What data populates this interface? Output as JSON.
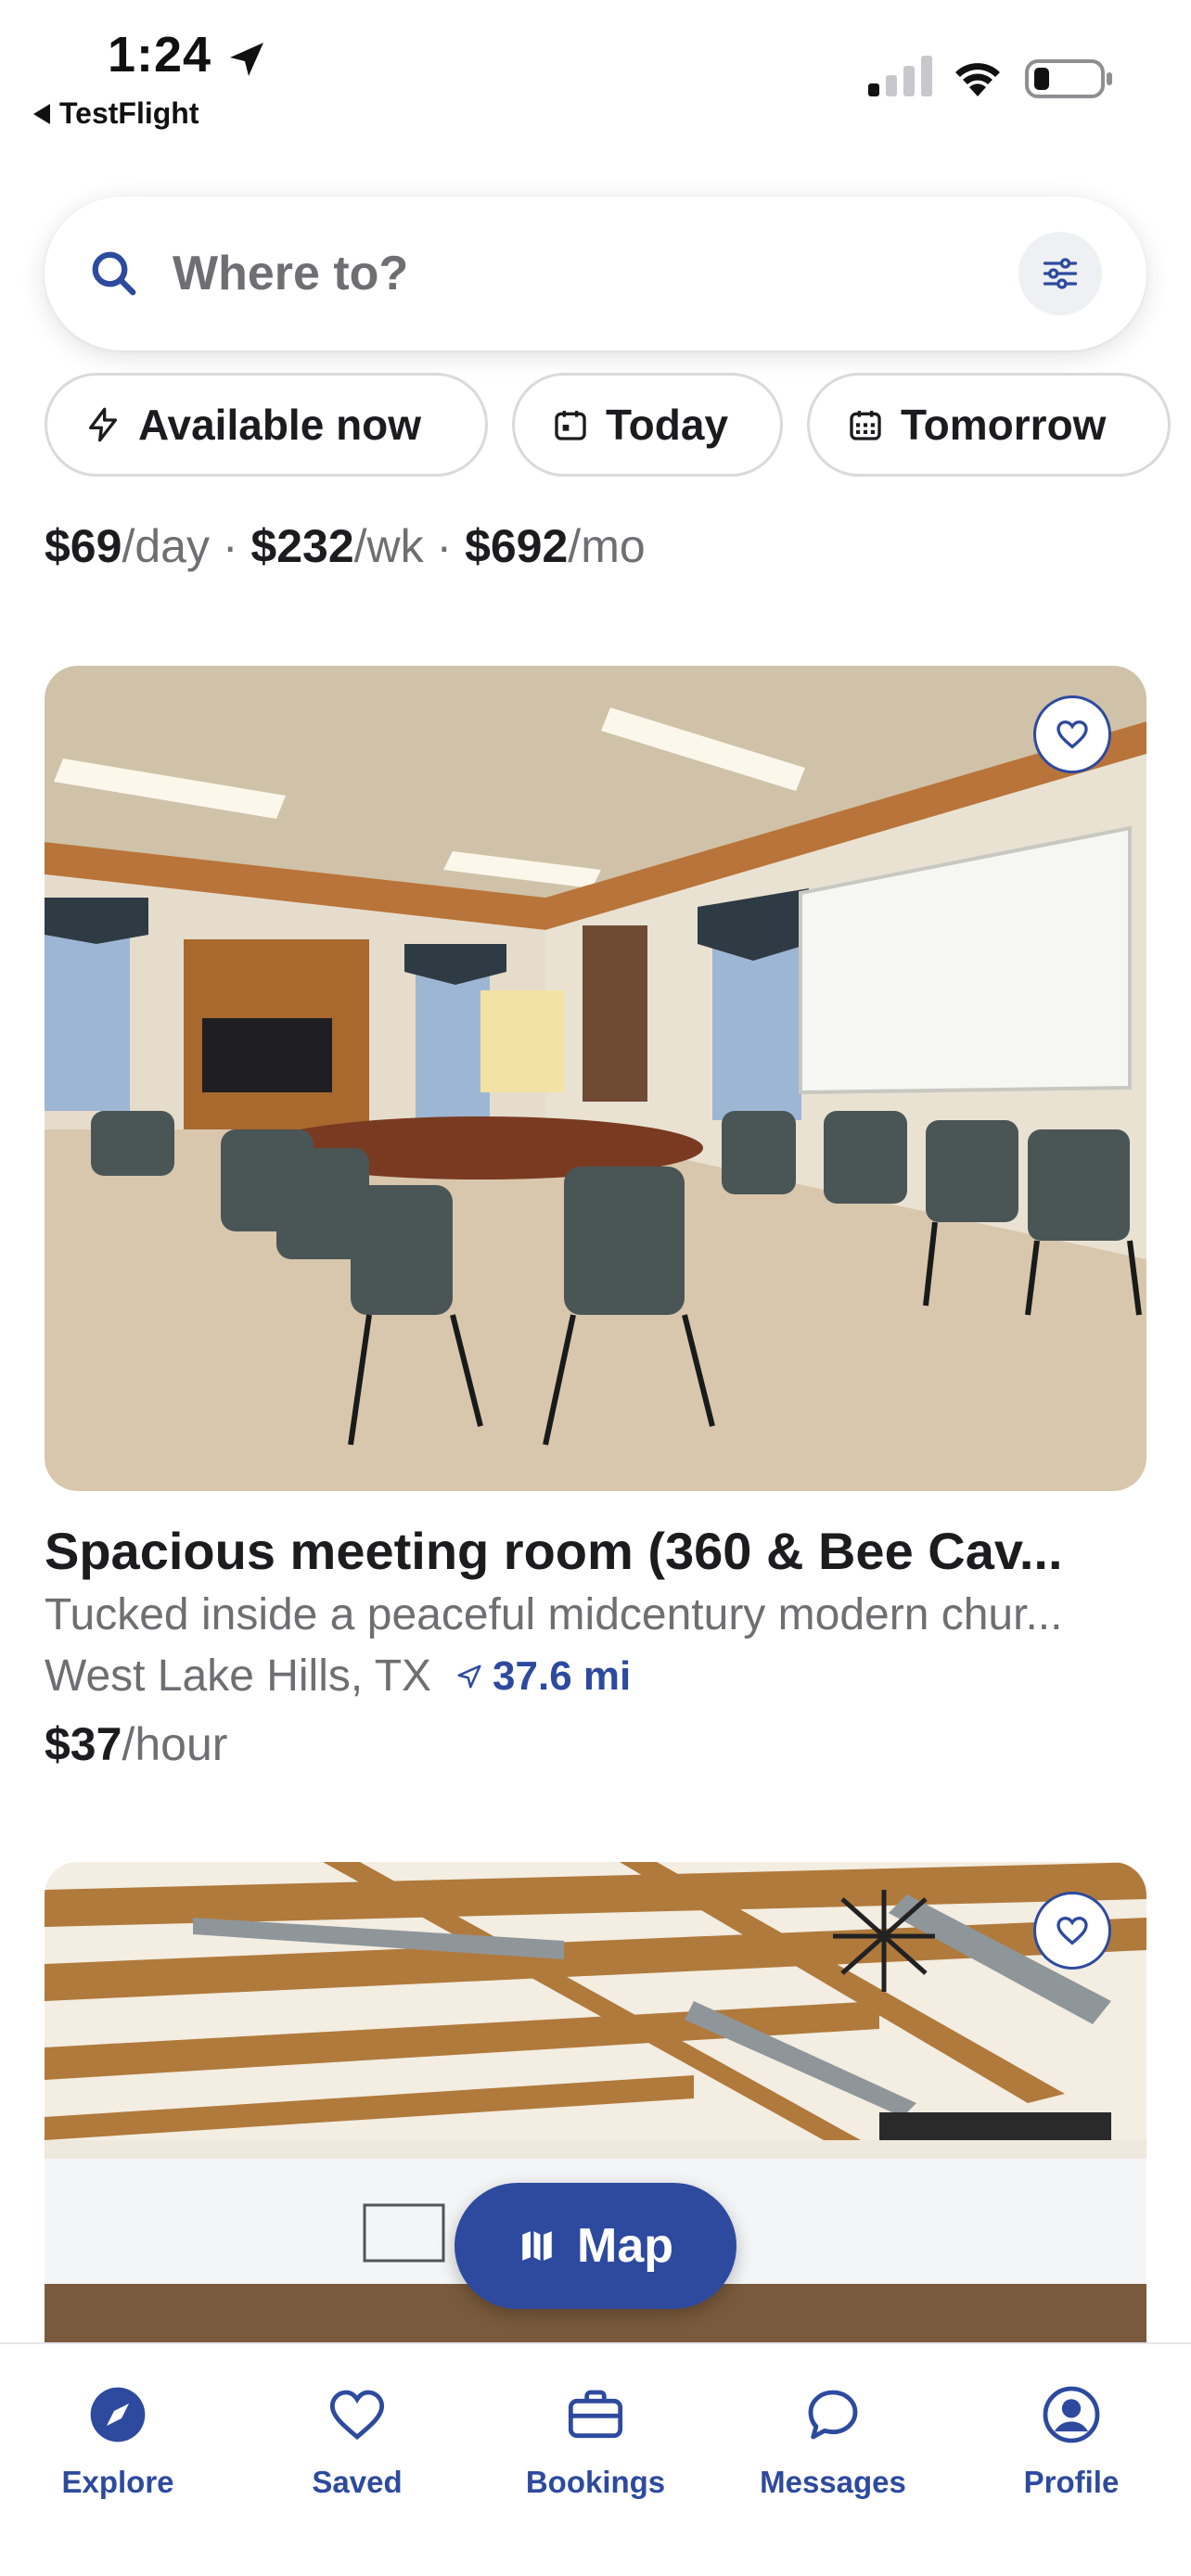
{
  "status_bar": {
    "time": "1:24",
    "back_app": "TestFlight"
  },
  "search": {
    "placeholder": "Where to?"
  },
  "chips": [
    {
      "label": "Available now",
      "icon": "lightning-icon"
    },
    {
      "label": "Today",
      "icon": "calendar-today-icon"
    },
    {
      "label": "Tomorrow",
      "icon": "calendar-icon"
    }
  ],
  "previous_listing": {
    "day_price": "$69",
    "day_unit": "/day",
    "week_price": "$232",
    "week_unit": "/wk",
    "month_price": "$692",
    "month_unit": "/mo",
    "separator": " · "
  },
  "listing": {
    "title": "Spacious meeting room (360 & Bee Cav...",
    "description": "Tucked inside a peaceful midcentury modern chur...",
    "location": "West Lake Hills, TX",
    "distance": "37.6 mi",
    "price": "$37",
    "price_unit": "/hour"
  },
  "map_button": {
    "label": "Map"
  },
  "tabs": [
    {
      "label": "Explore",
      "icon": "compass-icon"
    },
    {
      "label": "Saved",
      "icon": "heart-icon"
    },
    {
      "label": "Bookings",
      "icon": "briefcase-icon"
    },
    {
      "label": "Messages",
      "icon": "chat-bubble-icon"
    },
    {
      "label": "Profile",
      "icon": "user-circle-icon"
    }
  ],
  "colors": {
    "accent": "#2d4a9e",
    "muted_text": "#6e6e73",
    "primary_text": "#1c1c1e"
  }
}
